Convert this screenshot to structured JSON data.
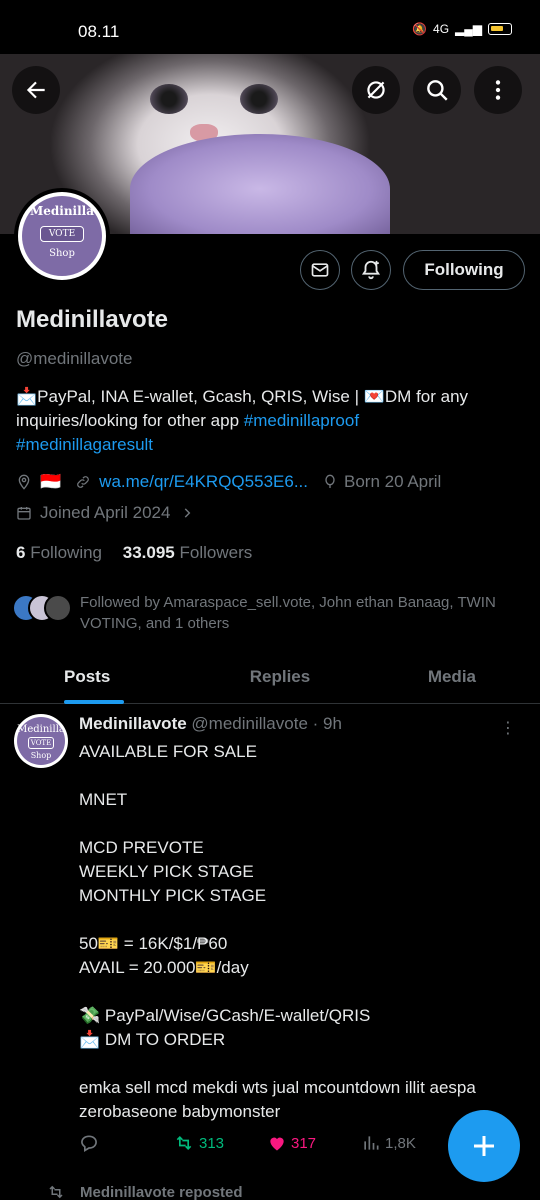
{
  "status_bar": {
    "time": "08.11",
    "network": "4G"
  },
  "header": {
    "back_label": "Back",
    "colors": {
      "accent": "#1d9bf0",
      "like": "#f91880",
      "retweet": "#00ba7c"
    }
  },
  "profile": {
    "avatar_text_top": "Medinilla",
    "avatar_text_mid": "VOTE",
    "avatar_text_bottom": "Shop",
    "following_button": "Following",
    "name": "Medinillavote",
    "handle": "@medinillavote",
    "bio_prefix": "📩PayPal, INA E-wallet, Gcash, QRIS, Wise | 💌DM for any inquiries/looking for other app ",
    "bio_tag1": "#medinillaproof",
    "bio_tag2": "#medinillagaresult",
    "location_flag": "🇮🇩",
    "website": "wa.me/qr/E4KRQQ553E6...",
    "born": "Born 20 April",
    "joined": "Joined April 2024",
    "following_count": "6",
    "following_label": "Following",
    "followers_count": "33.095",
    "followers_label": "Followers",
    "followed_by": "Followed by Amaraspace_sell.vote, John ethan Banaag, TWIN VOTING, and 1 others"
  },
  "tabs": [
    {
      "label": "Posts"
    },
    {
      "label": "Replies"
    },
    {
      "label": "Media"
    }
  ],
  "tweet": {
    "author": "Medinillavote",
    "meta": "@medinillavote · 9h",
    "body": "AVAILABLE FOR SALE\n\nMNET\n\nMCD PREVOTE\nWEEKLY PICK STAGE\nMONTHLY PICK STAGE\n\n50🎫 = 16K/$1/₱60\nAVAIL = 20.000🎫/day\n\n💸 PayPal/Wise/GCash/E-wallet/QRIS\n📩 DM TO ORDER\n\nemka sell mcd mekdi wts jual mcountdown illit aespa zerobaseone babymonster",
    "retweets": "313",
    "likes": "317",
    "views": "1,8K"
  },
  "next": {
    "repost_label": "Medinillavote reposted"
  }
}
